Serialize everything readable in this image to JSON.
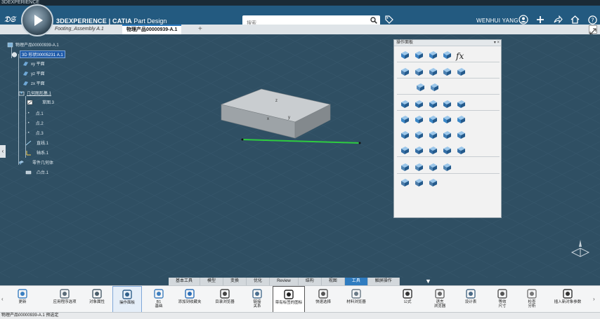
{
  "os_title": "3DEXPERIENCE",
  "header": {
    "brand_prefix": "3DEXPERIENCE | ",
    "brand_app": "CATIA",
    "brand_suffix": " Part Design",
    "search_placeholder": "搜索",
    "user_name": "WENHUI YANG"
  },
  "tabs": [
    {
      "label": "Footing_Assembly A.1"
    },
    {
      "label": "物理产品00000939-A.1"
    }
  ],
  "tree": {
    "root": "物理产品00000939-A.1",
    "part": "3D 形状00005231 A.1",
    "xy": "xy 平面",
    "yz": "yz 平面",
    "zx": "zx 平面",
    "geoset": "几何图形集.1",
    "sketch": "草图.3",
    "pt1": "点.1",
    "pt2": "点.2",
    "pt3": "点.3",
    "line": "直线.1",
    "axis": "轴系.1",
    "body": "零件几何体",
    "pad": "凸台.1"
  },
  "model_labels": {
    "z": "z",
    "x": "x",
    "y": "y"
  },
  "panel": {
    "title": "操作面板",
    "controls": "▾ ×",
    "fx": "fx"
  },
  "section_tabs": [
    "基本工具",
    "模型",
    "变换",
    "优化",
    "Review",
    "结构",
    "视图",
    "工具",
    "触屏操作"
  ],
  "active_section": "工具",
  "action_bar": [
    {
      "label": "更新",
      "icon": "update-icon"
    },
    {
      "label": "应用程序选项",
      "icon": "app-options-icon"
    },
    {
      "label": "对象属性",
      "icon": "properties-icon"
    },
    {
      "label": "操作面板",
      "icon": "action-panel-icon"
    },
    {
      "label": "B1\n基础",
      "icon": "b1-icon"
    },
    {
      "label": "添加到收藏夹",
      "icon": "favorites-icon"
    },
    {
      "label": "目录浏览器",
      "icon": "catalog-icon"
    },
    {
      "label": "链接\n关系",
      "icon": "links-icon"
    },
    {
      "label": "带有标签的图标",
      "icon": "labeled-icon"
    },
    {
      "label": "快速选择",
      "icon": "quick-select-icon"
    },
    {
      "label": "材料浏览器",
      "icon": "material-icon"
    },
    {
      "label": "公式",
      "icon": "formula-icon"
    },
    {
      "label": "语言\n浏览器",
      "icon": "language-icon"
    },
    {
      "label": "设计表",
      "icon": "design-table-icon"
    },
    {
      "label": "等效\n尺寸",
      "icon": "equivalent-dim-icon"
    },
    {
      "label": "检查\n分析",
      "icon": "check-analysis-icon"
    },
    {
      "label": "插入新对象参数",
      "icon": "insert-param-icon"
    }
  ],
  "status": "物理产品00000939-A.1 预选定",
  "colors": {
    "header": "#235a80",
    "viewport": "#2f4f63",
    "accent": "#2f7cc0",
    "green_line": "#2ecc40"
  }
}
